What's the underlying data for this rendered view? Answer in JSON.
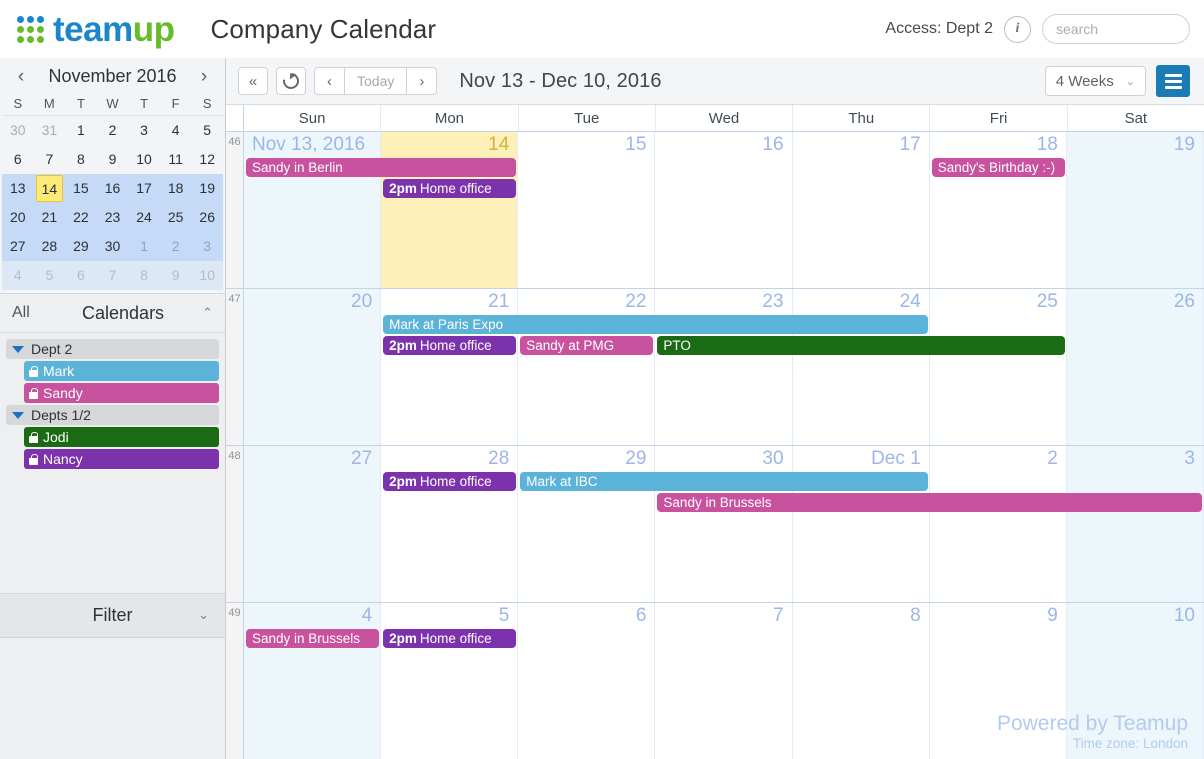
{
  "header": {
    "logo_text_1": "team",
    "logo_text_2": "up",
    "calendar_title": "Company Calendar",
    "access_label": "Access: Dept 2",
    "info_icon_label": "i",
    "search_placeholder": "search",
    "search_value": ""
  },
  "sidebar": {
    "mini_calendar": {
      "prev_label": "‹",
      "next_label": "›",
      "month_title": "November 2016",
      "dow": [
        "S",
        "M",
        "T",
        "W",
        "T",
        "F",
        "S"
      ],
      "weeks": [
        {
          "selected": false,
          "tail": false,
          "days": [
            {
              "n": "30",
              "muted": true
            },
            {
              "n": "31",
              "muted": true
            },
            {
              "n": "1"
            },
            {
              "n": "2"
            },
            {
              "n": "3"
            },
            {
              "n": "4"
            },
            {
              "n": "5"
            }
          ]
        },
        {
          "selected": false,
          "tail": false,
          "days": [
            {
              "n": "6"
            },
            {
              "n": "7"
            },
            {
              "n": "8"
            },
            {
              "n": "9"
            },
            {
              "n": "10"
            },
            {
              "n": "11"
            },
            {
              "n": "12"
            }
          ]
        },
        {
          "selected": true,
          "tail": false,
          "days": [
            {
              "n": "13"
            },
            {
              "n": "14",
              "today": true
            },
            {
              "n": "15"
            },
            {
              "n": "16"
            },
            {
              "n": "17"
            },
            {
              "n": "18"
            },
            {
              "n": "19"
            }
          ]
        },
        {
          "selected": true,
          "tail": false,
          "days": [
            {
              "n": "20"
            },
            {
              "n": "21"
            },
            {
              "n": "22"
            },
            {
              "n": "23"
            },
            {
              "n": "24"
            },
            {
              "n": "25"
            },
            {
              "n": "26"
            }
          ]
        },
        {
          "selected": true,
          "tail": false,
          "days": [
            {
              "n": "27"
            },
            {
              "n": "28"
            },
            {
              "n": "29"
            },
            {
              "n": "30"
            },
            {
              "n": "1",
              "muted": true
            },
            {
              "n": "2",
              "muted": true
            },
            {
              "n": "3",
              "muted": true
            }
          ]
        },
        {
          "selected": false,
          "tail": true,
          "days": [
            {
              "n": "4"
            },
            {
              "n": "5"
            },
            {
              "n": "6"
            },
            {
              "n": "7"
            },
            {
              "n": "8"
            },
            {
              "n": "9"
            },
            {
              "n": "10"
            }
          ]
        }
      ]
    },
    "calendars_panel": {
      "all_label": "All",
      "title": "Calendars",
      "collapse_icon": "⌃",
      "groups": [
        {
          "name": "Dept 2",
          "items": [
            {
              "name": "Mark",
              "color": "#5cb3d9"
            },
            {
              "name": "Sandy",
              "color": "#c8529e"
            }
          ]
        },
        {
          "name": "Depts 1/2",
          "items": [
            {
              "name": "Jodi",
              "color": "#1a6b14"
            },
            {
              "name": "Nancy",
              "color": "#7c32ab"
            }
          ]
        }
      ]
    },
    "filter": {
      "title": "Filter",
      "expand_icon": "⌄"
    }
  },
  "toolbar": {
    "collapse_label": "«",
    "refresh_label": "refresh",
    "prev_label": "‹",
    "today_label": "Today",
    "next_label": "›",
    "range_title": "Nov 13 - Dec 10, 2016",
    "view_label": "4 Weeks",
    "view_caret": "⌄",
    "menu_label": "menu"
  },
  "calendar": {
    "dow_headers": [
      "Sun",
      "Mon",
      "Tue",
      "Wed",
      "Thu",
      "Fri",
      "Sat"
    ],
    "weeks": [
      {
        "week_number": "46",
        "days": [
          {
            "label": "Nov 13, 2016",
            "first": true,
            "weekend": true
          },
          {
            "label": "14",
            "today": true
          },
          {
            "label": "15"
          },
          {
            "label": "16"
          },
          {
            "label": "17"
          },
          {
            "label": "18"
          },
          {
            "label": "19",
            "weekend": true
          }
        ],
        "events": [
          {
            "title": "Sandy in Berlin",
            "start": 0,
            "span": 2,
            "row": 0,
            "color": "#c8529e"
          },
          {
            "title": "Home office",
            "time": "2pm",
            "start": 1,
            "span": 1,
            "row": 1,
            "color": "#7c32ab"
          },
          {
            "title": "Sandy's Birthday :-)",
            "start": 5,
            "span": 1,
            "row": 0,
            "color": "#c8529e"
          }
        ]
      },
      {
        "week_number": "47",
        "days": [
          {
            "label": "20",
            "weekend": true
          },
          {
            "label": "21"
          },
          {
            "label": "22"
          },
          {
            "label": "23"
          },
          {
            "label": "24"
          },
          {
            "label": "25"
          },
          {
            "label": "26",
            "weekend": true
          }
        ],
        "events": [
          {
            "title": "Mark at Paris Expo",
            "start": 1,
            "span": 4,
            "row": 0,
            "color": "#5cb3d9"
          },
          {
            "title": "Home office",
            "time": "2pm",
            "start": 1,
            "span": 1,
            "row": 1,
            "color": "#7c32ab"
          },
          {
            "title": "Sandy at PMG",
            "start": 2,
            "span": 1,
            "row": 1,
            "color": "#c8529e"
          },
          {
            "title": "PTO",
            "start": 3,
            "span": 3,
            "row": 1,
            "color": "#1a6b14"
          }
        ]
      },
      {
        "week_number": "48",
        "days": [
          {
            "label": "27",
            "weekend": true
          },
          {
            "label": "28"
          },
          {
            "label": "29"
          },
          {
            "label": "30"
          },
          {
            "label": "Dec 1"
          },
          {
            "label": "2"
          },
          {
            "label": "3",
            "weekend": true
          }
        ],
        "events": [
          {
            "title": "Home office",
            "time": "2pm",
            "start": 1,
            "span": 1,
            "row": 0,
            "color": "#7c32ab"
          },
          {
            "title": "Mark at IBC",
            "start": 2,
            "span": 3,
            "row": 0,
            "color": "#5cb3d9"
          },
          {
            "title": "Sandy in Brussels",
            "start": 3,
            "span": 4,
            "row": 1,
            "color": "#c8529e"
          }
        ]
      },
      {
        "week_number": "49",
        "days": [
          {
            "label": "4",
            "weekend": true
          },
          {
            "label": "5"
          },
          {
            "label": "6"
          },
          {
            "label": "7"
          },
          {
            "label": "8"
          },
          {
            "label": "9"
          },
          {
            "label": "10",
            "weekend": true
          }
        ],
        "events": [
          {
            "title": "Sandy in Brussels",
            "start": 0,
            "span": 1,
            "row": 0,
            "color": "#c8529e"
          },
          {
            "title": "Home office",
            "time": "2pm",
            "start": 1,
            "span": 1,
            "row": 0,
            "color": "#7c32ab"
          }
        ]
      }
    ],
    "footer": {
      "powered_by": "Powered by Teamup",
      "timezone": "Time zone: London"
    }
  }
}
